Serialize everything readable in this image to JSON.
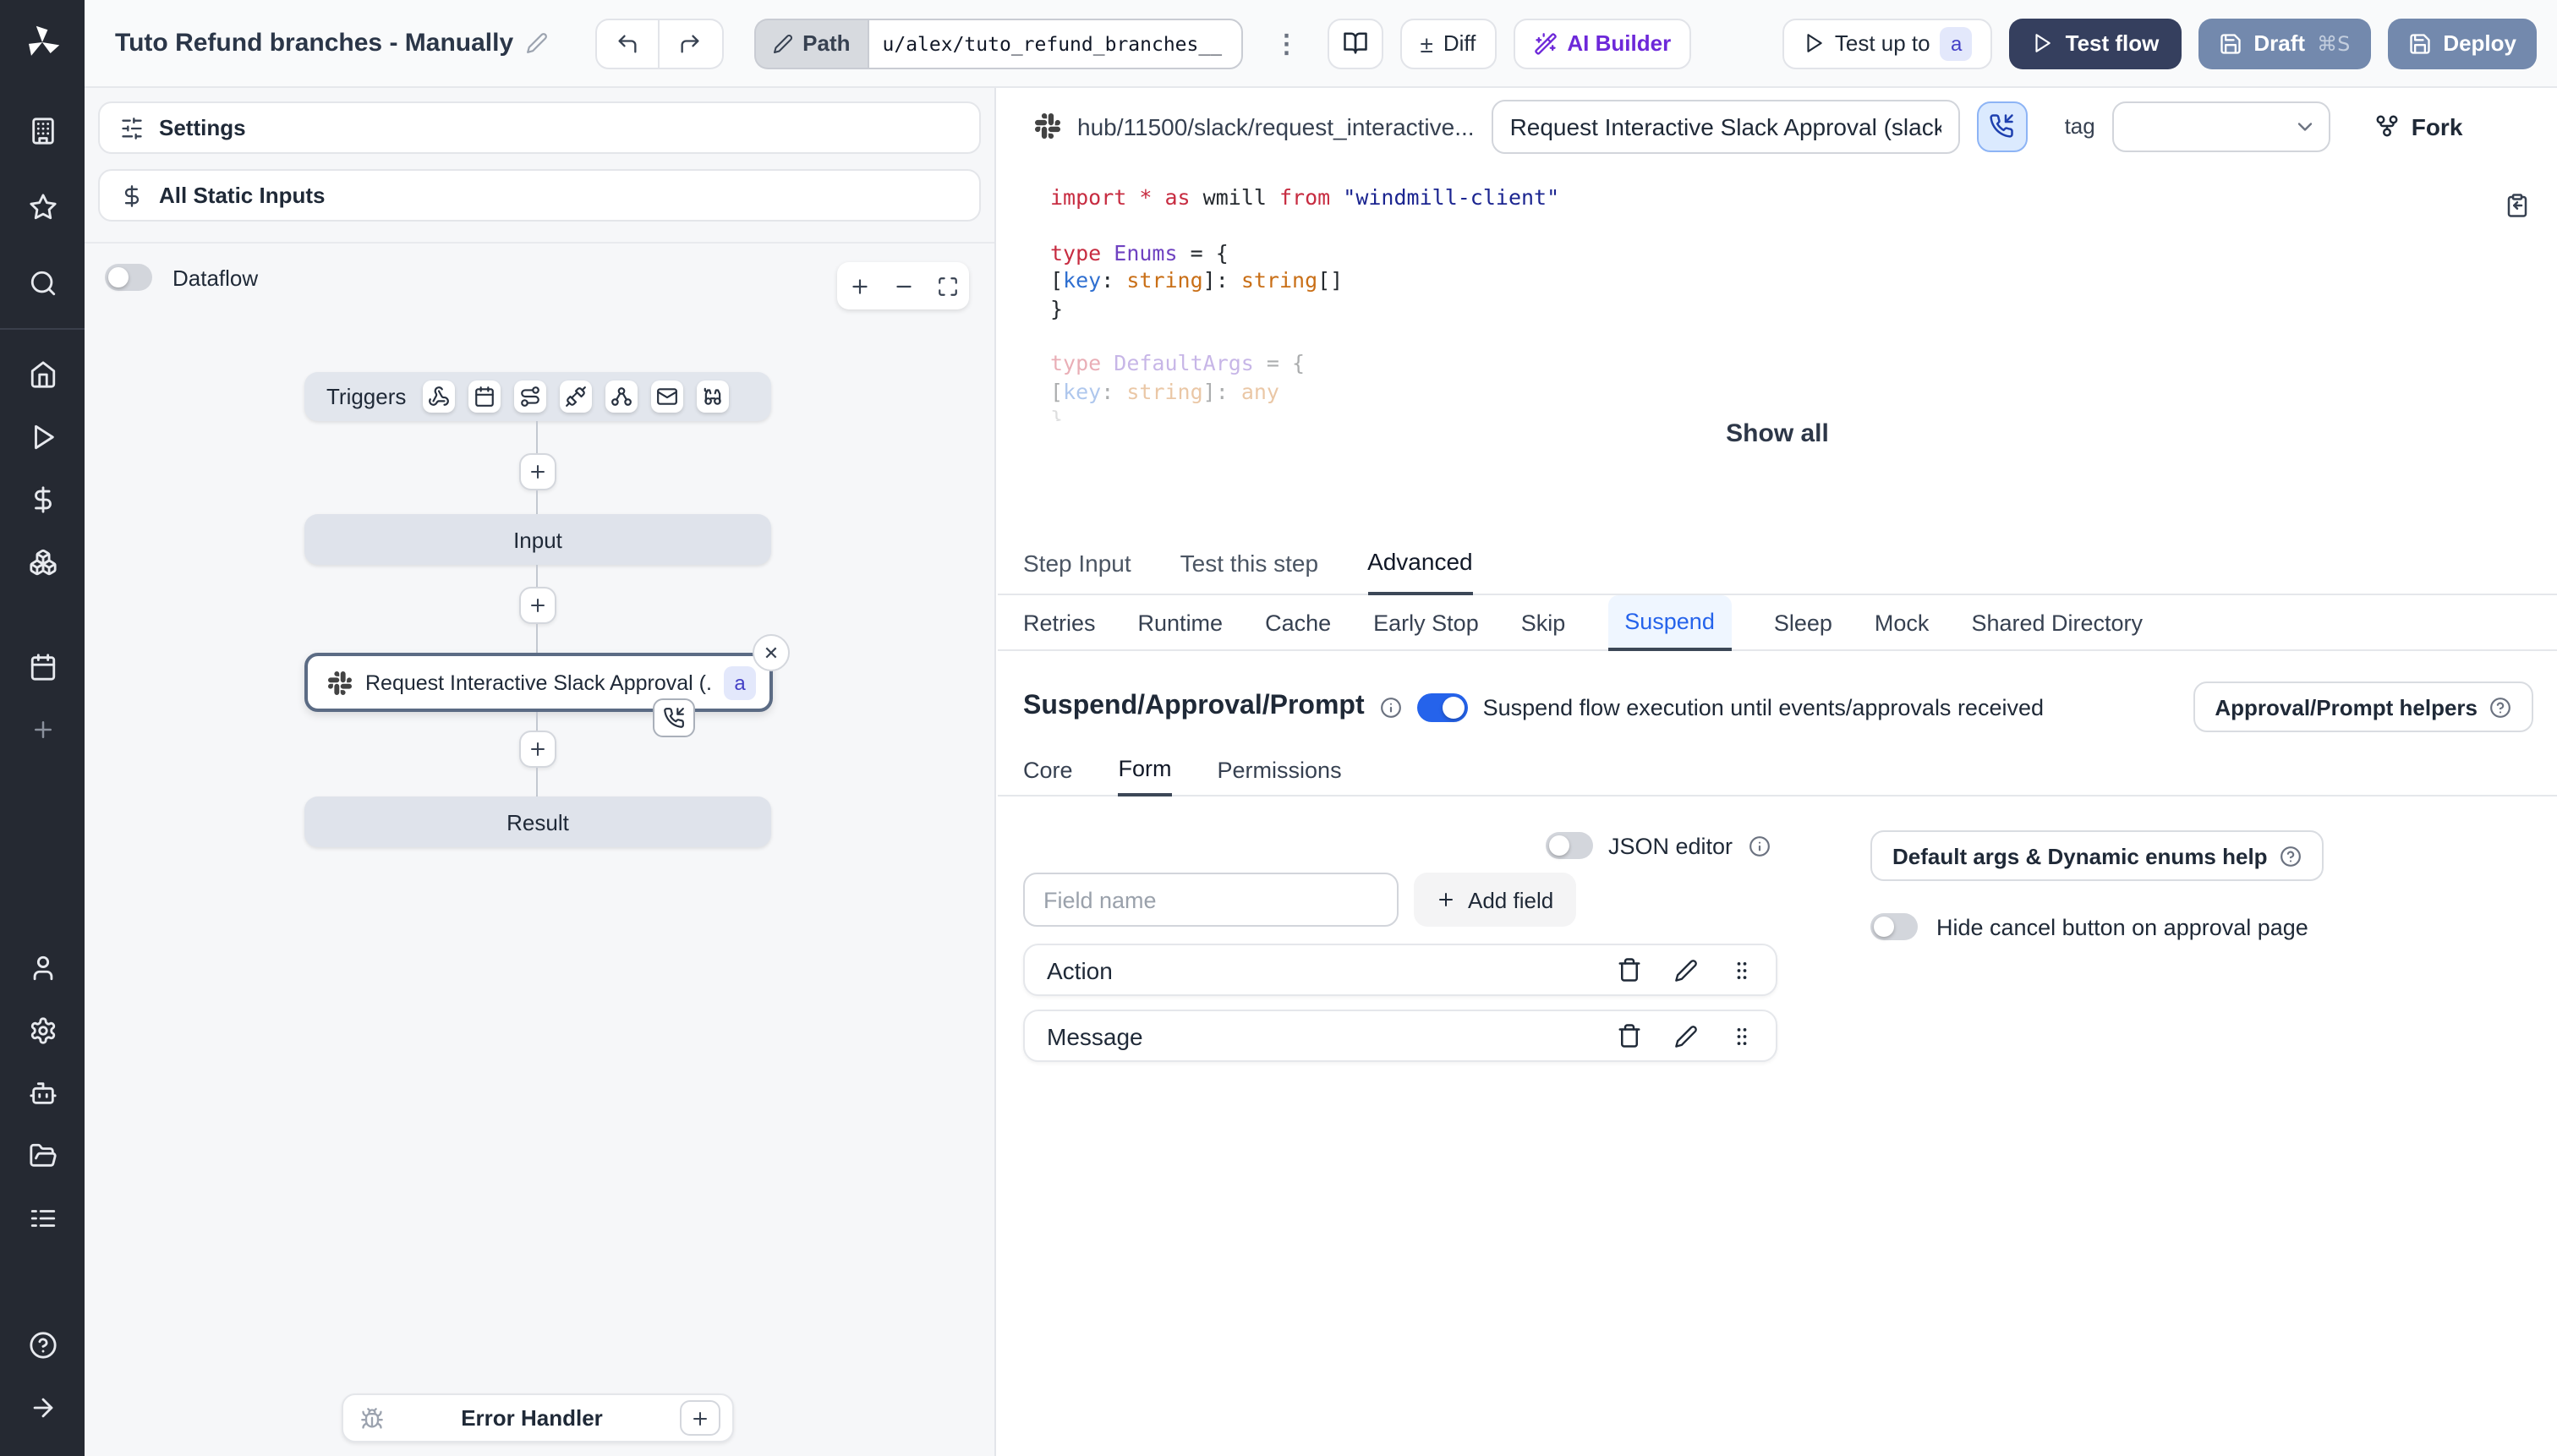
{
  "topbar": {
    "title": "Tuto Refund branches - Manually",
    "path_label": "Path",
    "path_value": "u/alex/tuto_refund_branches__",
    "diff": "Diff",
    "ai_builder": "AI Builder",
    "test_up_to": "Test up to",
    "test_up_to_badge": "a",
    "test_flow": "Test flow",
    "draft": "Draft",
    "draft_shortcut": "⌘S",
    "deploy": "Deploy"
  },
  "flow_panel": {
    "settings": "Settings",
    "all_static_inputs": "All Static Inputs",
    "dataflow": "Dataflow",
    "graph": {
      "triggers": "Triggers",
      "input": "Input",
      "step_label": "Request Interactive Slack Approval (...",
      "step_badge": "a",
      "result": "Result",
      "error_handler": "Error Handler"
    }
  },
  "step_panel": {
    "header": {
      "hub_path": "hub/11500/slack/request_interactive...",
      "summary": "Request Interactive Slack Approval (slack",
      "tag_label": "tag",
      "fork": "Fork"
    },
    "code": {
      "lines": [
        {
          "tokens": [
            {
              "t": "import",
              "c": "kw"
            },
            {
              "t": " ",
              "c": "pl"
            },
            {
              "t": "*",
              "c": "kw"
            },
            {
              "t": " ",
              "c": "pl"
            },
            {
              "t": "as",
              "c": "kw"
            },
            {
              "t": " wmill ",
              "c": "pl"
            },
            {
              "t": "from",
              "c": "kw"
            },
            {
              "t": " ",
              "c": "pl"
            },
            {
              "t": "\"windmill-client\"",
              "c": "str"
            }
          ]
        },
        {
          "tokens": []
        },
        {
          "tokens": [
            {
              "t": "type",
              "c": "kw"
            },
            {
              "t": " ",
              "c": "pl"
            },
            {
              "t": "Enums",
              "c": "typ"
            },
            {
              "t": " = {",
              "c": "pl"
            }
          ]
        },
        {
          "tokens": [
            {
              "t": "  [",
              "c": "pl"
            },
            {
              "t": "key",
              "c": "prop"
            },
            {
              "t": ": ",
              "c": "pl"
            },
            {
              "t": "string",
              "c": "bi"
            },
            {
              "t": "]: ",
              "c": "pl"
            },
            {
              "t": "string",
              "c": "bi"
            },
            {
              "t": "[]",
              "c": "pl"
            }
          ]
        },
        {
          "tokens": [
            {
              "t": "}",
              "c": "pl"
            }
          ]
        },
        {
          "tokens": []
        },
        {
          "tokens": [
            {
              "t": "type",
              "c": "kw"
            },
            {
              "t": " ",
              "c": "pl"
            },
            {
              "t": "DefaultArgs",
              "c": "typ"
            },
            {
              "t": " = {",
              "c": "pl"
            }
          ],
          "faded": true
        },
        {
          "tokens": [
            {
              "t": "  [",
              "c": "pl"
            },
            {
              "t": "key",
              "c": "prop"
            },
            {
              "t": ": ",
              "c": "pl"
            },
            {
              "t": "string",
              "c": "bi"
            },
            {
              "t": "]: ",
              "c": "pl"
            },
            {
              "t": "any",
              "c": "bi"
            }
          ],
          "faded": true
        },
        {
          "tokens": [
            {
              "t": "}",
              "c": "pl"
            }
          ],
          "faded": true,
          "cut": true
        }
      ]
    },
    "show_all": "Show all",
    "tabs": [
      "Step Input",
      "Test this step",
      "Advanced"
    ],
    "tabs_active": "Advanced",
    "advanced_tabs": [
      "Retries",
      "Runtime",
      "Cache",
      "Early Stop",
      "Skip",
      "Suspend",
      "Sleep",
      "Mock",
      "Shared Directory"
    ],
    "advanced_tabs_active": "Suspend",
    "suspend": {
      "heading": "Suspend/Approval/Prompt",
      "toggle_label": "Suspend flow execution until events/approvals received",
      "toggle_on": true,
      "helpers_button": "Approval/Prompt helpers",
      "subtabs": [
        "Core",
        "Form",
        "Permissions"
      ],
      "subtabs_active": "Form",
      "form": {
        "json_editor": "JSON editor",
        "field_placeholder": "Field name",
        "add_field": "Add field",
        "fields": [
          "Action",
          "Message"
        ],
        "default_args_help": "Default args & Dynamic enums help",
        "hide_cancel": "Hide cancel button on approval page"
      }
    }
  },
  "icons_text": {
    "kebab": "⋮",
    "diff": "±",
    "close": "✕",
    "plus": "+",
    "minus": "−"
  },
  "colors": {
    "accent": "#2563eb",
    "sidebar_bg": "#252932",
    "test_flow_bg": "#353f5e",
    "deploy_bg": "#7389ad",
    "selected_node_border": "#5b6b84"
  }
}
